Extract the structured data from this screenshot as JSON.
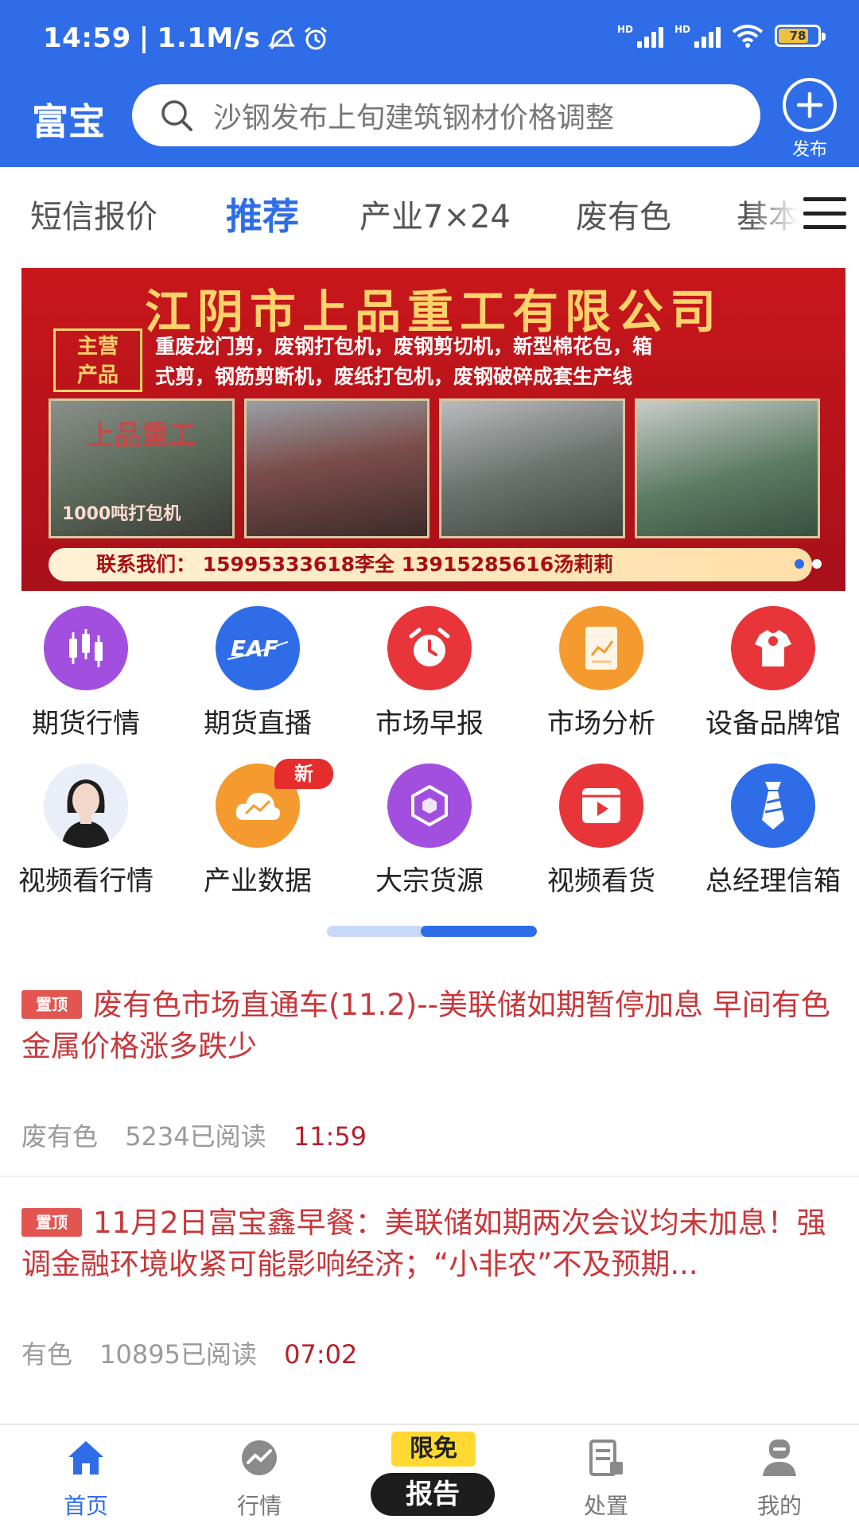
{
  "status_bar": {
    "time": "14:59",
    "network_speed": "1.1M/s",
    "signal_label": "HD",
    "battery": "78",
    "battery_level": 0.78
  },
  "header": {
    "brand": "富宝",
    "search_placeholder": "沙钢发布上旬建筑钢材价格调整",
    "publish_label": "发布"
  },
  "tabs": [
    {
      "label": "短信报价",
      "active": false
    },
    {
      "label": "推荐",
      "active": true
    },
    {
      "label": "产业7×24",
      "active": false
    },
    {
      "label": "废有色",
      "active": false
    },
    {
      "label": "基本",
      "active": false
    }
  ],
  "banner": {
    "title": "江阴市上品重工有限公司",
    "tag_line1": "主营",
    "tag_line2": "产品",
    "products_line1": "重废龙门剪，废钢打包机，废钢剪切机，新型棉花包，箱",
    "products_line2": "式剪，钢筋剪断机，废纸打包机，废钢破碎成套生产线",
    "photo_mark": "上品重工",
    "photo_caption": "1000吨打包机",
    "contact": "联系我们：  15995333618李全    13915285616汤莉莉",
    "slide_count": 2,
    "active_slide": 1
  },
  "grid": [
    {
      "label": "期货行情",
      "icon": "candlestick-icon",
      "color": "#a24fe0"
    },
    {
      "label": "期货直播",
      "icon": "eaf-logo-icon",
      "color": "#2f6de8"
    },
    {
      "label": "市场早报",
      "icon": "alarm-clock-icon",
      "color": "#e8353a"
    },
    {
      "label": "市场分析",
      "icon": "report-chart-icon",
      "color": "#f59a2f"
    },
    {
      "label": "设备品牌馆",
      "icon": "wrench-shirt-icon",
      "color": "#e8353a"
    },
    {
      "label": "视频看行情",
      "icon": "presenter-avatar",
      "color": "#e9eef8"
    },
    {
      "label": "产业数据",
      "icon": "cloud-chart-icon",
      "color": "#f59a2f",
      "badge": "新"
    },
    {
      "label": "大宗货源",
      "icon": "hexagon-icon",
      "color": "#a24fe0"
    },
    {
      "label": "视频看货",
      "icon": "video-play-icon",
      "color": "#e8353a"
    },
    {
      "label": "总经理信箱",
      "icon": "tie-icon",
      "color": "#2f6de8"
    }
  ],
  "grid_pager": {
    "pages": 2,
    "active": 2
  },
  "news": [
    {
      "badge": "置顶",
      "title": "废有色市场直通车(11.2)--美联储如期暂停加息 早间有色金属价格涨多跌少",
      "category": "废有色",
      "reads": "5234已阅读",
      "time": "11:59"
    },
    {
      "badge": "置顶",
      "title": "11月2日富宝鑫早餐：美联储如期两次会议均未加息！强调金融环境收紧可能影响经济；“小非农”不及预期...",
      "category": "有色",
      "reads": "10895已阅读",
      "time": "07:02"
    }
  ],
  "bottom_nav": [
    {
      "label": "首页",
      "icon": "home-icon",
      "active": true
    },
    {
      "label": "行情",
      "icon": "trend-icon",
      "active": false
    },
    {
      "label": "报告",
      "icon": "report-icon",
      "active": false,
      "promo": "限免"
    },
    {
      "label": "处置",
      "icon": "disposal-icon",
      "active": false
    },
    {
      "label": "我的",
      "icon": "profile-icon",
      "active": false
    }
  ],
  "colors": {
    "brand_blue": "#2f6de8",
    "headline_red": "#c8373a",
    "banner_red": "#c8171b"
  }
}
